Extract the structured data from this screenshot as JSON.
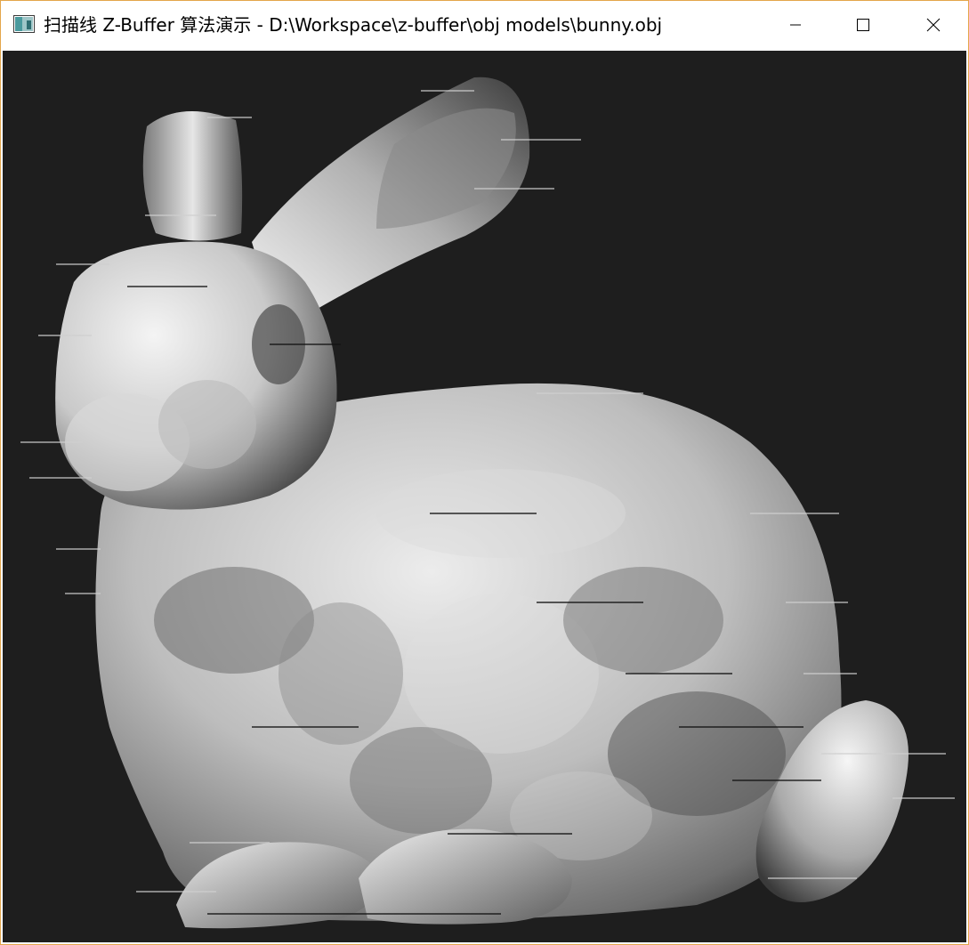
{
  "window": {
    "title": "扫描线 Z-Buffer 算法演示 - D:\\Workspace\\z-buffer\\obj models\\bunny.obj",
    "icon": "app-window-icon",
    "controls": {
      "minimize": "minimize-icon",
      "maximize": "maximize-icon",
      "close": "close-icon"
    }
  },
  "viewport": {
    "background_color": "#1e1e1e",
    "model_shading": "grayscale",
    "model_name": "bunny.obj"
  }
}
